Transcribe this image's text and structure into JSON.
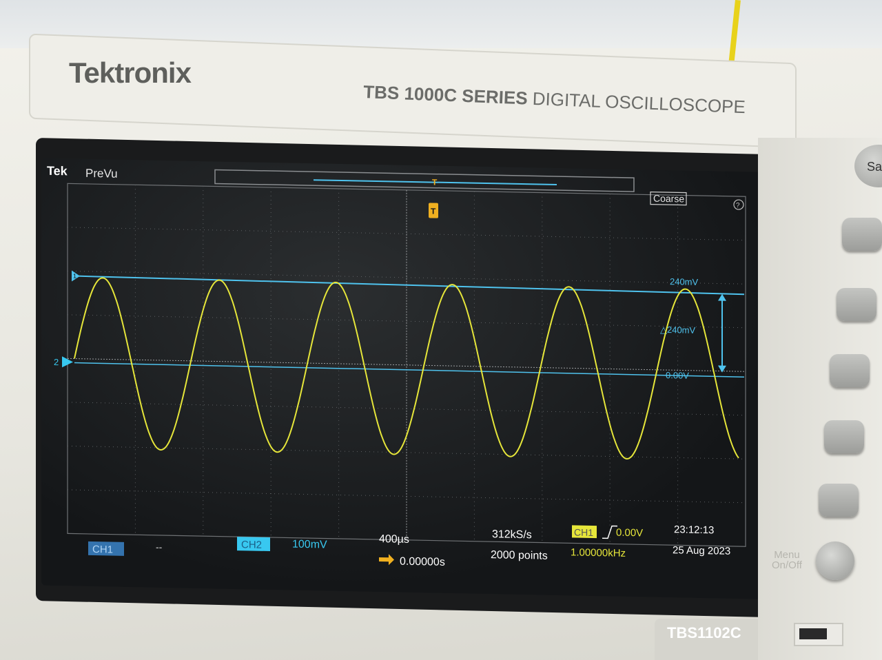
{
  "brand": "Tektronix",
  "series": {
    "bold": "TBS 1000C SERIES",
    "rest": "DIGITAL OSCILLOSCOPE"
  },
  "model": "TBS1102C",
  "side_labels": {
    "save": "Sa",
    "menu": "Menu",
    "onoff": "On/Off"
  },
  "screen": {
    "tek": "Tek",
    "mode": "PreVu",
    "coarse": "Coarse",
    "trigger_marker": "T",
    "cursor_top": "240mV",
    "cursor_delta": "△240mV",
    "cursor_bottom": "0.00V",
    "ch2_marker": "2",
    "ch1_marker": "1",
    "status": {
      "ch1_label": "CH1",
      "ch1_scale": "--",
      "ch2_label": "CH2",
      "ch2_scale": "100mV",
      "timebase": "400µs",
      "position": "0.00000s",
      "sample_rate": "312kS/s",
      "record_length": "2000 points",
      "trigger_source": "CH1",
      "trigger_level": "0.00V",
      "frequency": "1.00000kHz",
      "time": "23:12:13",
      "date": "25 Aug 2023"
    },
    "colors": {
      "ch1": "#3a84c9",
      "ch2": "#38c8f0",
      "waveform": "#e6e63a",
      "cursor": "#4fc3ee",
      "grid": "#8a8d90"
    }
  }
}
